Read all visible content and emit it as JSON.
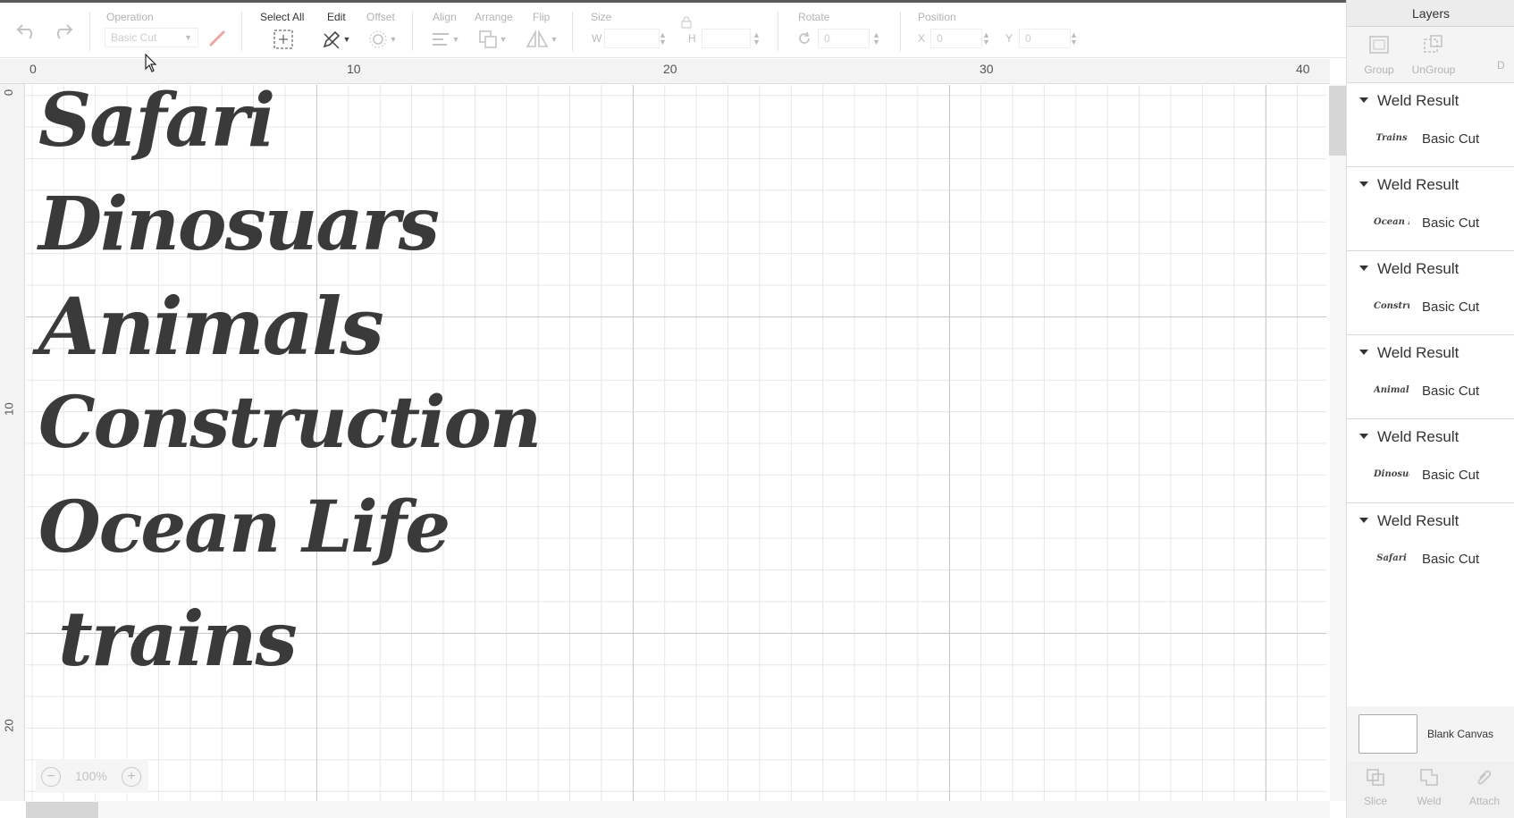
{
  "toolbar": {
    "operation_label": "Operation",
    "operation_value": "Basic Cut",
    "select_all_label": "Select All",
    "edit_label": "Edit",
    "offset_label": "Offset",
    "align_label": "Align",
    "arrange_label": "Arrange",
    "flip_label": "Flip",
    "size_label": "Size",
    "w_label": "W",
    "h_label": "H",
    "rotate_label": "Rotate",
    "rotate_value": "0",
    "position_label": "Position",
    "x_label": "X",
    "x_value": "0",
    "y_label": "Y",
    "y_value": "0"
  },
  "ruler": {
    "top": [
      "0",
      "10",
      "20",
      "30",
      "40"
    ],
    "left": [
      "0",
      "10",
      "20"
    ]
  },
  "canvas": {
    "words": [
      "Safari",
      "Dinosuars",
      "Animals",
      "Construction",
      "Ocean Life",
      "trains"
    ]
  },
  "zoom": {
    "value": "100%",
    "minus": "−",
    "plus": "+"
  },
  "layers": {
    "title": "Layers",
    "actions": [
      "Group",
      "UnGroup",
      "D"
    ],
    "groups": [
      {
        "title": "Weld Result",
        "thumb": "Trains",
        "operation": "Basic Cut"
      },
      {
        "title": "Weld Result",
        "thumb": "Ocean Life",
        "operation": "Basic Cut"
      },
      {
        "title": "Weld Result",
        "thumb": "Construction",
        "operation": "Basic Cut"
      },
      {
        "title": "Weld Result",
        "thumb": "Animals",
        "operation": "Basic Cut"
      },
      {
        "title": "Weld Result",
        "thumb": "Dinosuars",
        "operation": "Basic Cut"
      },
      {
        "title": "Weld Result",
        "thumb": "Safari",
        "operation": "Basic Cut"
      }
    ],
    "blank_canvas_label": "Blank Canvas",
    "bottom_actions": [
      "Slice",
      "Weld",
      "Attach"
    ]
  }
}
